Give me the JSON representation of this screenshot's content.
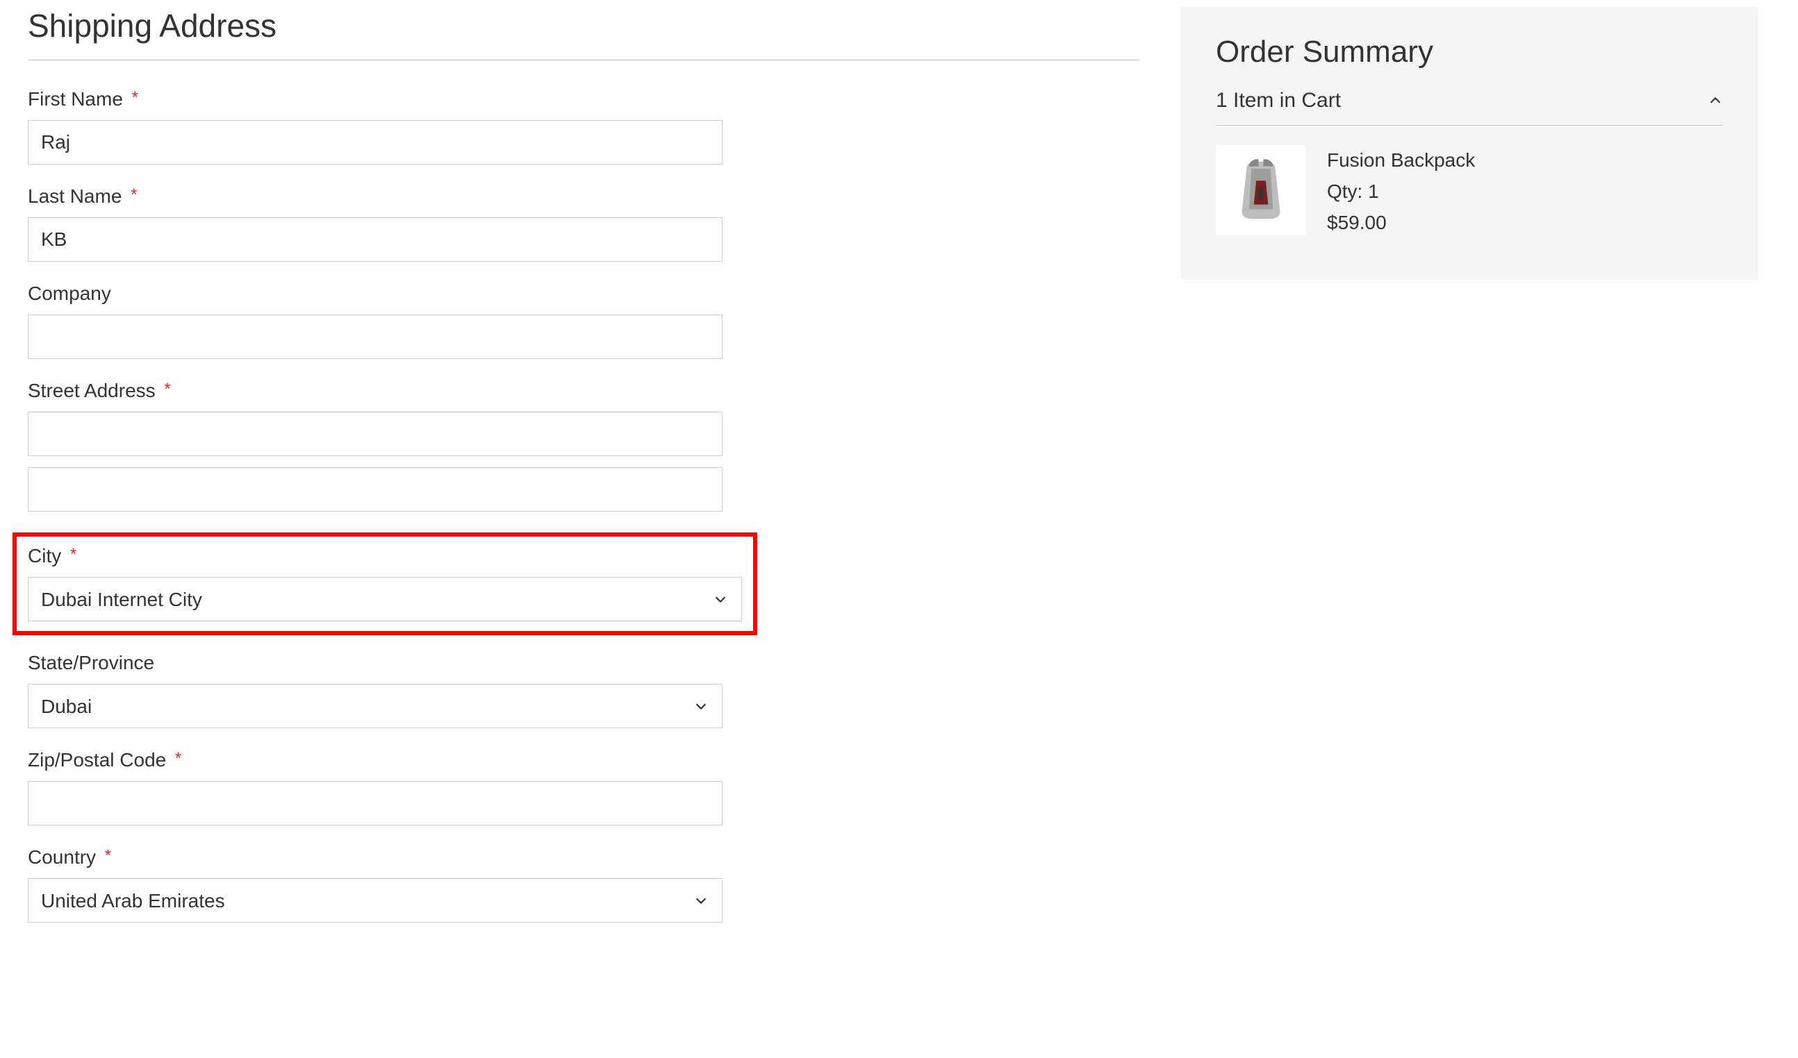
{
  "section_title": "Shipping Address",
  "fields": {
    "first_name": {
      "label": "First Name",
      "value": "Raj"
    },
    "last_name": {
      "label": "Last Name",
      "value": "KB"
    },
    "company": {
      "label": "Company",
      "value": ""
    },
    "street": {
      "label": "Street Address",
      "line1": "",
      "line2": ""
    },
    "city": {
      "label": "City",
      "value": "Dubai Internet City"
    },
    "state": {
      "label": "State/Province",
      "value": "Dubai"
    },
    "zip": {
      "label": "Zip/Postal Code",
      "value": ""
    },
    "country": {
      "label": "Country",
      "value": "United Arab Emirates"
    }
  },
  "summary": {
    "title": "Order Summary",
    "cart_header": "1 Item in Cart",
    "items": [
      {
        "name": "Fusion Backpack",
        "qty_label": "Qty: 1",
        "price": "$59.00"
      }
    ]
  }
}
